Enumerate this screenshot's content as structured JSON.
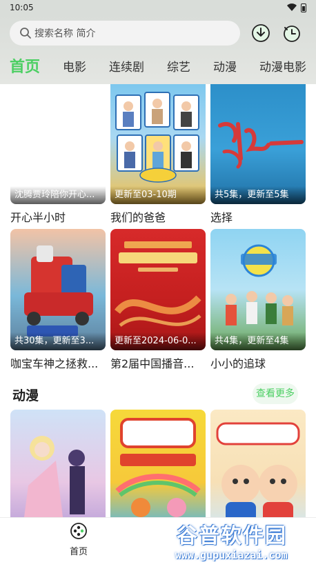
{
  "status_bar": {
    "time": "10:05"
  },
  "search": {
    "placeholder": "搜索名称 简介"
  },
  "tabs": [
    "首页",
    "电影",
    "连续剧",
    "综艺",
    "动漫",
    "动漫电影"
  ],
  "rows": [
    [
      {
        "title": "开心半小时",
        "badge": "沈腾贾玲陪你开心..."
      },
      {
        "title": "我们的爸爸",
        "badge": "更新至03-10期"
      },
      {
        "title": "选择",
        "badge": "共5集，更新至5集"
      }
    ],
    [
      {
        "title": "咖宝车神之拯救...",
        "badge": "共30集，更新至3..."
      },
      {
        "title": "第2届中国播音...",
        "badge": "更新至2024-06-0..."
      },
      {
        "title": "小小的追球",
        "badge": "共4集，更新至4集"
      }
    ]
  ],
  "anime_section": {
    "title": "动漫",
    "more_label": "查看更多"
  },
  "bottom_nav": {
    "home_label": "首页"
  },
  "watermark": {
    "cn": "谷普软件园",
    "url": "www.gupuxiazai.com"
  },
  "colors": {
    "accent": "#4ccf63",
    "header_bg": "#d9ddd9"
  }
}
